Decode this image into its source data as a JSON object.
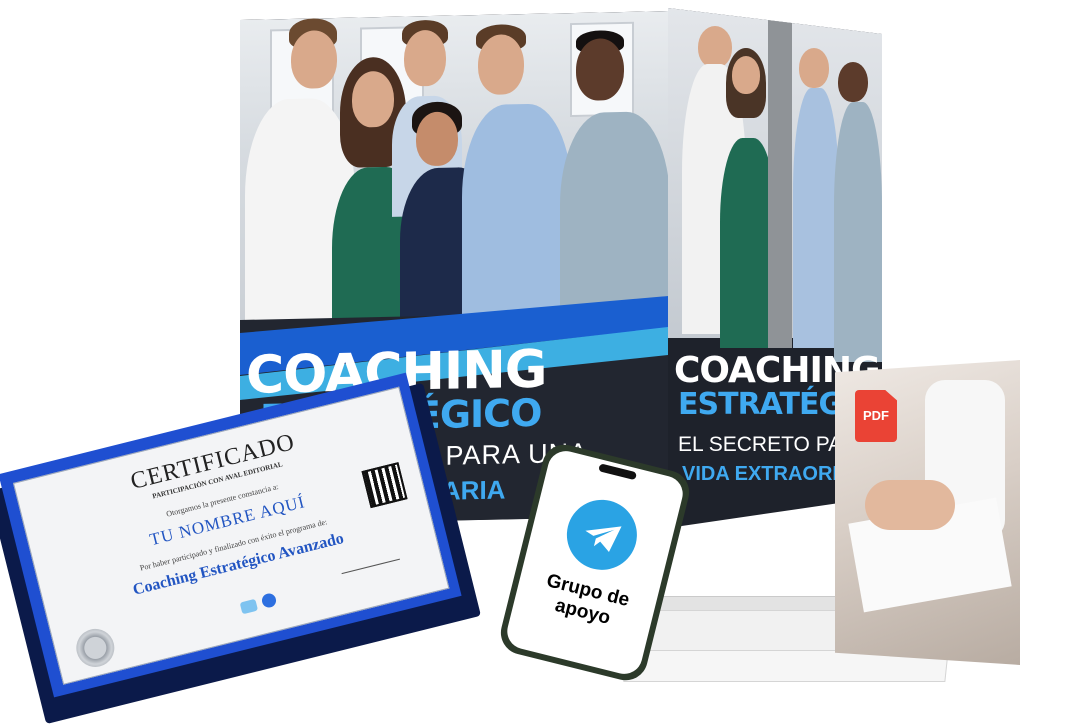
{
  "box": {
    "title": "COACHING",
    "subtitle": "ESTRATÉGICO",
    "tagline_1": "EL SECRETO PARA UNA",
    "tagline_2": "VIDA EXTRAORDINARIA",
    "front_tagline_1": "SECRETO PARA UNA",
    "front_tagline_2": "EXTRAORDINARIA"
  },
  "certificate": {
    "title": "CERTIFICADO",
    "subtitle": "PARTICIPACIÓN CON AVAL EDITORIAL",
    "line_1": "Otorgamos la presente constancia a:",
    "name": "TU NOMBRE AQUÍ",
    "line_2": "Por haber participado y finalizado con éxito el programa de:",
    "program": "Coaching Estratégico Avanzado"
  },
  "phone": {
    "label": "Grupo de apoyo",
    "icon": "telegram-icon"
  },
  "pdf": {
    "label": "PDF",
    "icon": "pdf-icon"
  },
  "colors": {
    "brand_blue": "#1a5fd0",
    "accent_cyan": "#3fb6ec",
    "dark_band": "#222630",
    "telegram": "#2aa3e4",
    "pdf_red": "#ea4335"
  }
}
